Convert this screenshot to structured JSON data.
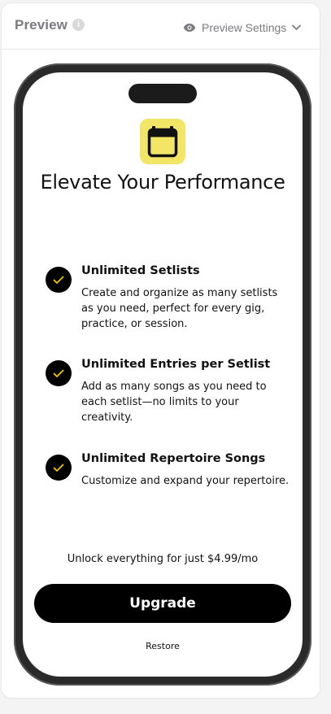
{
  "panel": {
    "title": "Preview",
    "info_icon": "info-icon",
    "settings_label": "Preview Settings",
    "settings_icon": "eye-icon",
    "settings_chevron": "chevron-down-icon"
  },
  "paywall": {
    "app_icon": "calendar-icon",
    "app_icon_color": "#f3e565",
    "headline": "Elevate Your Performance",
    "features": [
      {
        "title": "Unlimited Setlists",
        "description": "Create and organize as many setlists as you need, perfect for every gig, practice, or session."
      },
      {
        "title": "Unlimited Entries per Setlist",
        "description": "Add as many songs as you need to each setlist—no limits to your creativity."
      },
      {
        "title": "Unlimited Repertoire Songs",
        "description": "Customize and expand your repertoire."
      }
    ],
    "check_color": "#f5c400",
    "unlock_text": "Unlock everything for just $4.99/mo",
    "upgrade_label": "Upgrade",
    "restore_label": "Restore"
  }
}
